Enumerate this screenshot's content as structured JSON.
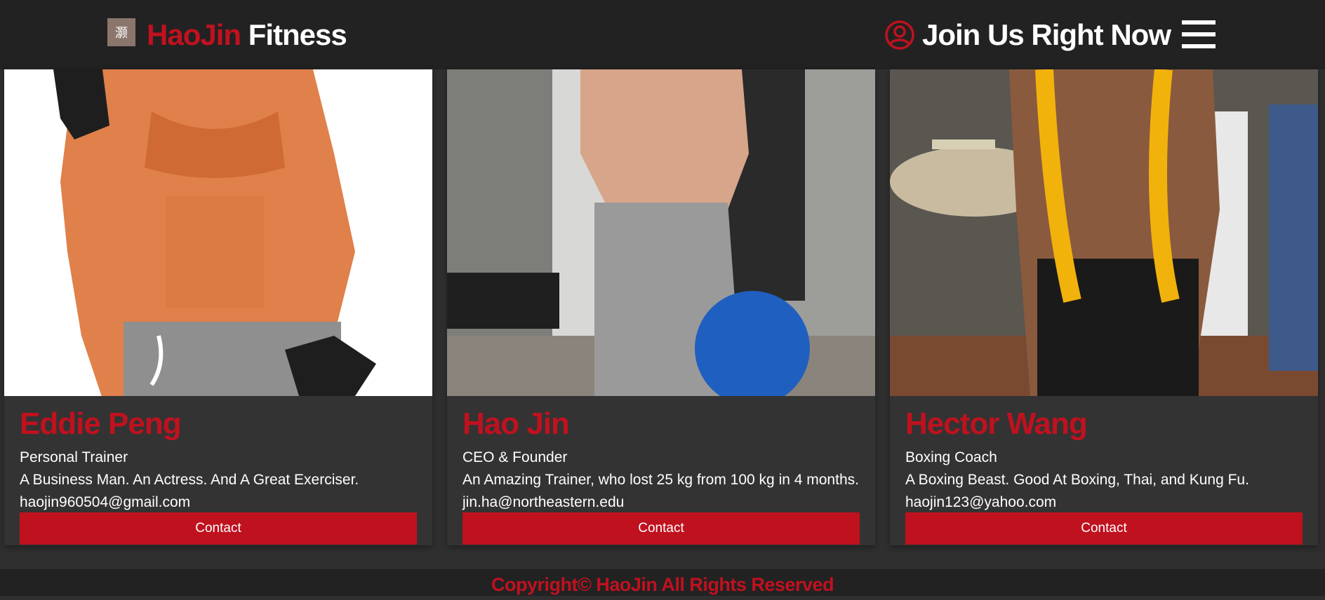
{
  "header": {
    "logo_glyph": "灏",
    "brand_red": "HaoJin",
    "brand_white": "Fitness",
    "join_label": "Join Us Right Now",
    "user_icon": "user-circle-icon",
    "menu_icon": "hamburger-menu-icon"
  },
  "colors": {
    "accent": "#c0111f",
    "header_bg": "#222222",
    "page_bg": "#2f2f2f",
    "card_bg": "#333333"
  },
  "trainers": [
    {
      "name": "Eddie Peng",
      "role": "Personal Trainer",
      "description": "A Business Man. An Actress. And A Great Exerciser.",
      "email": "haojin960504@gmail.com",
      "button": "Contact"
    },
    {
      "name": "Hao Jin",
      "role": "CEO & Founder",
      "description": "An Amazing Trainer, who lost 25 kg from 100 kg in 4 months.",
      "email": "jin.ha@northeastern.edu",
      "button": "Contact"
    },
    {
      "name": "Hector Wang",
      "role": "Boxing Coach",
      "description": "A Boxing Beast. Good At Boxing, Thai, and Kung Fu.",
      "email": "haojin123@yahoo.com",
      "button": "Contact"
    }
  ],
  "footer": {
    "copyright": "Copyright© HaoJin All Rights Reserved"
  }
}
